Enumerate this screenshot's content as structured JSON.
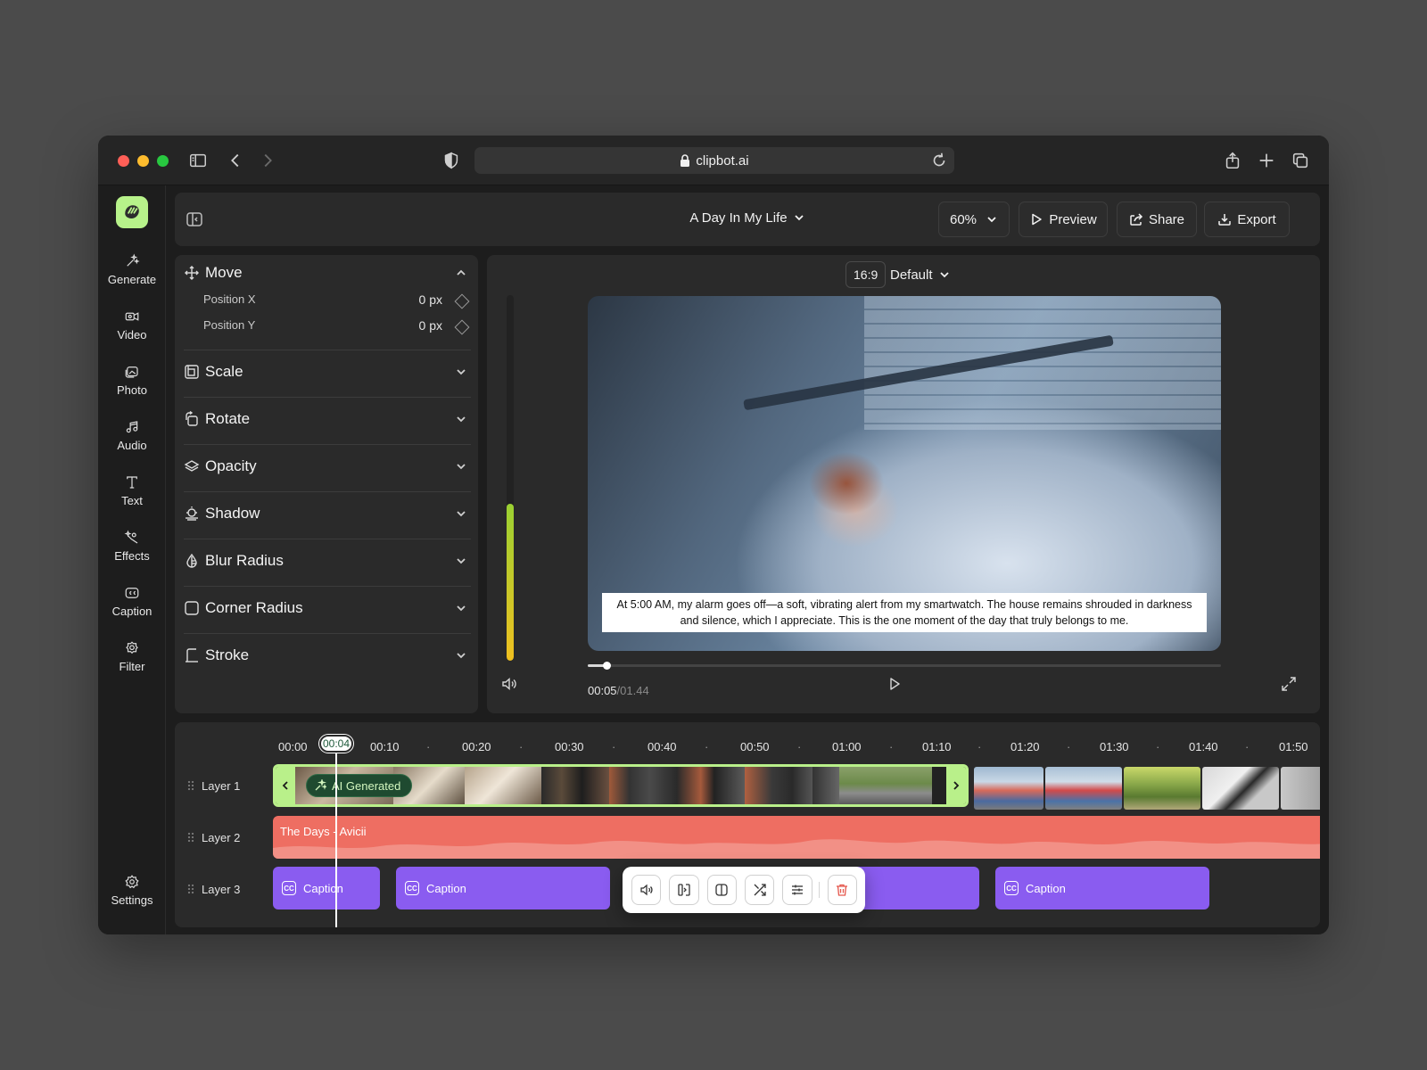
{
  "browser": {
    "url": "clipbot.ai"
  },
  "sidebar": {
    "items": [
      {
        "label": "Generate",
        "icon": "wand-sparkle-icon"
      },
      {
        "label": "Video",
        "icon": "video-camera-icon"
      },
      {
        "label": "Photo",
        "icon": "photo-icon"
      },
      {
        "label": "Audio",
        "icon": "music-note-icon"
      },
      {
        "label": "Text",
        "icon": "text-icon"
      },
      {
        "label": "Effects",
        "icon": "effects-icon"
      },
      {
        "label": "Caption",
        "icon": "caption-icon"
      },
      {
        "label": "Filter",
        "icon": "filter-icon"
      }
    ],
    "settings_label": "Settings"
  },
  "header": {
    "project_title": "A Day In My Life",
    "zoom": "60%",
    "preview_label": "Preview",
    "share_label": "Share",
    "export_label": "Export"
  },
  "properties": {
    "move": {
      "label": "Move",
      "position_x_label": "Position X",
      "position_x_value": "0 px",
      "position_y_label": "Position Y",
      "position_y_value": "0 px"
    },
    "sections": [
      "Scale",
      "Rotate",
      "Opacity",
      "Shadow",
      "Blur Radius",
      "Corner Radius",
      "Stroke"
    ]
  },
  "preview": {
    "aspect_ratio": "16:9",
    "preset": "Default",
    "caption_text": "At 5:00 AM, my alarm goes off—a soft, vibrating alert from my smartwatch. The house remains shrouded in darkness and silence, which I appreciate. This is the one moment of the day that truly belongs to me.",
    "current_time": "00:05",
    "total_time": "/01.44",
    "playback_progress": 0.03,
    "volume_level": 0.43
  },
  "timeline": {
    "ticks": [
      "00:00",
      "00:10",
      "·",
      "00:20",
      "·",
      "00:30",
      "·",
      "00:40",
      "·",
      "00:50",
      "·",
      "01:00",
      "·",
      "01:10",
      "·",
      "01:20",
      "·",
      "01:30",
      "·",
      "01:40",
      "·",
      "01:50"
    ],
    "playhead_time": "00:04",
    "layers": [
      "Layer 1",
      "Layer 2",
      "Layer 3"
    ],
    "ai_badge": "AI Generated",
    "audio_clip": "The Days - Avicii",
    "caption_clips": [
      "Caption",
      "Caption",
      "Caption"
    ]
  },
  "clip_toolbar": {
    "buttons": [
      "volume-icon",
      "split-icon",
      "crop-icon",
      "shuffle-icon",
      "adjust-icon",
      "trash-icon"
    ]
  },
  "colors": {
    "accent_green": "#b9f08a",
    "audio_track": "#ee6e62",
    "caption_track": "#8a5cf0",
    "background": "#1d1d1d"
  }
}
